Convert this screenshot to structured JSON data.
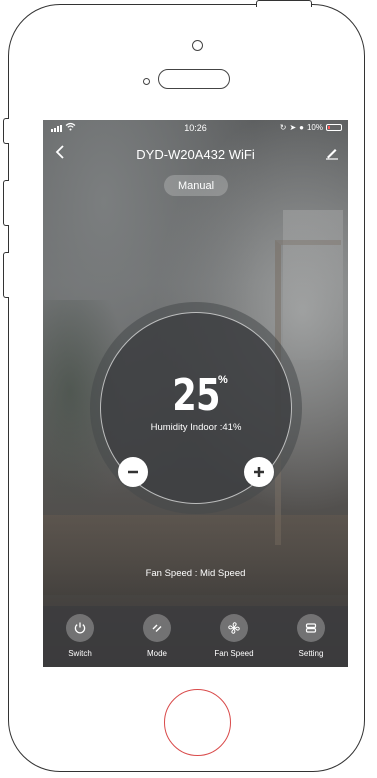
{
  "status_bar": {
    "time": "10:26",
    "battery": "10%"
  },
  "header": {
    "title": "DYD-W20A432 WiFi",
    "mode": "Manual"
  },
  "dial": {
    "value": "25",
    "unit": "%",
    "label": "Humidity Indoor :41%"
  },
  "fan_speed": "Fan Speed : Mid Speed",
  "toolbar": [
    {
      "label": "Switch",
      "icon": "power-icon"
    },
    {
      "label": "Mode",
      "icon": "mode-icon"
    },
    {
      "label": "Fan Speed",
      "icon": "fan-icon"
    },
    {
      "label": "Setting",
      "icon": "settings-icon"
    }
  ]
}
